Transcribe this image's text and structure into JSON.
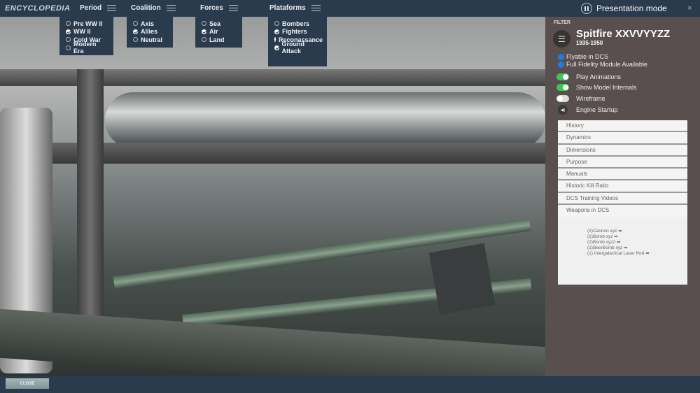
{
  "brand": "ENCYCLOPEDIA",
  "menus": [
    {
      "label": "Period",
      "options": [
        {
          "label": "Pre WW II",
          "checked": false
        },
        {
          "label": "WW II",
          "checked": true
        },
        {
          "label": "Cold War",
          "checked": false
        },
        {
          "label": "Modern Era",
          "checked": false
        }
      ]
    },
    {
      "label": "Coalition",
      "options": [
        {
          "label": "Axis",
          "checked": false
        },
        {
          "label": "Allies",
          "checked": true
        },
        {
          "label": "Neutral",
          "checked": false
        }
      ]
    },
    {
      "label": "Forces",
      "options": [
        {
          "label": "Sea",
          "checked": false
        },
        {
          "label": "Air",
          "checked": true
        },
        {
          "label": "Land",
          "checked": false
        }
      ]
    },
    {
      "label": "Plataforms",
      "options": [
        {
          "label": "Bombers",
          "checked": false
        },
        {
          "label": "Fighters",
          "checked": true
        },
        {
          "label": "Reconassance",
          "checked": true
        },
        {
          "label": "Ground Attack",
          "checked": true
        }
      ]
    }
  ],
  "presentation_label": "Presentation mode",
  "close_x": "×",
  "panel": {
    "filter_label": "FILTER",
    "title": "Spitfire XXVVYYZZ",
    "years": "1935-1950",
    "badges": [
      "Flyable in DCS",
      "Full Fidelity Module Available"
    ],
    "toggles": [
      {
        "label": "Play Animations",
        "on": true
      },
      {
        "label": "Show Model Internals",
        "on": true
      },
      {
        "label": "Wireframe",
        "on": false
      }
    ],
    "sound_label": "Engine Startup",
    "sections": [
      "History",
      "Dynamics",
      "Dimensions",
      "Purpose",
      "Manuals",
      "Historic Kill Ratio",
      "DCS Training Videos",
      "Weapons in DCS"
    ],
    "weapons": [
      "(2)Cannon xyz",
      "(1)Bomb xyz",
      "(2)Bomb xyz2",
      "(1)BeerBomb xyz",
      "(1) Intergalactical Laser Pod"
    ]
  },
  "close_button": "CLOSE"
}
